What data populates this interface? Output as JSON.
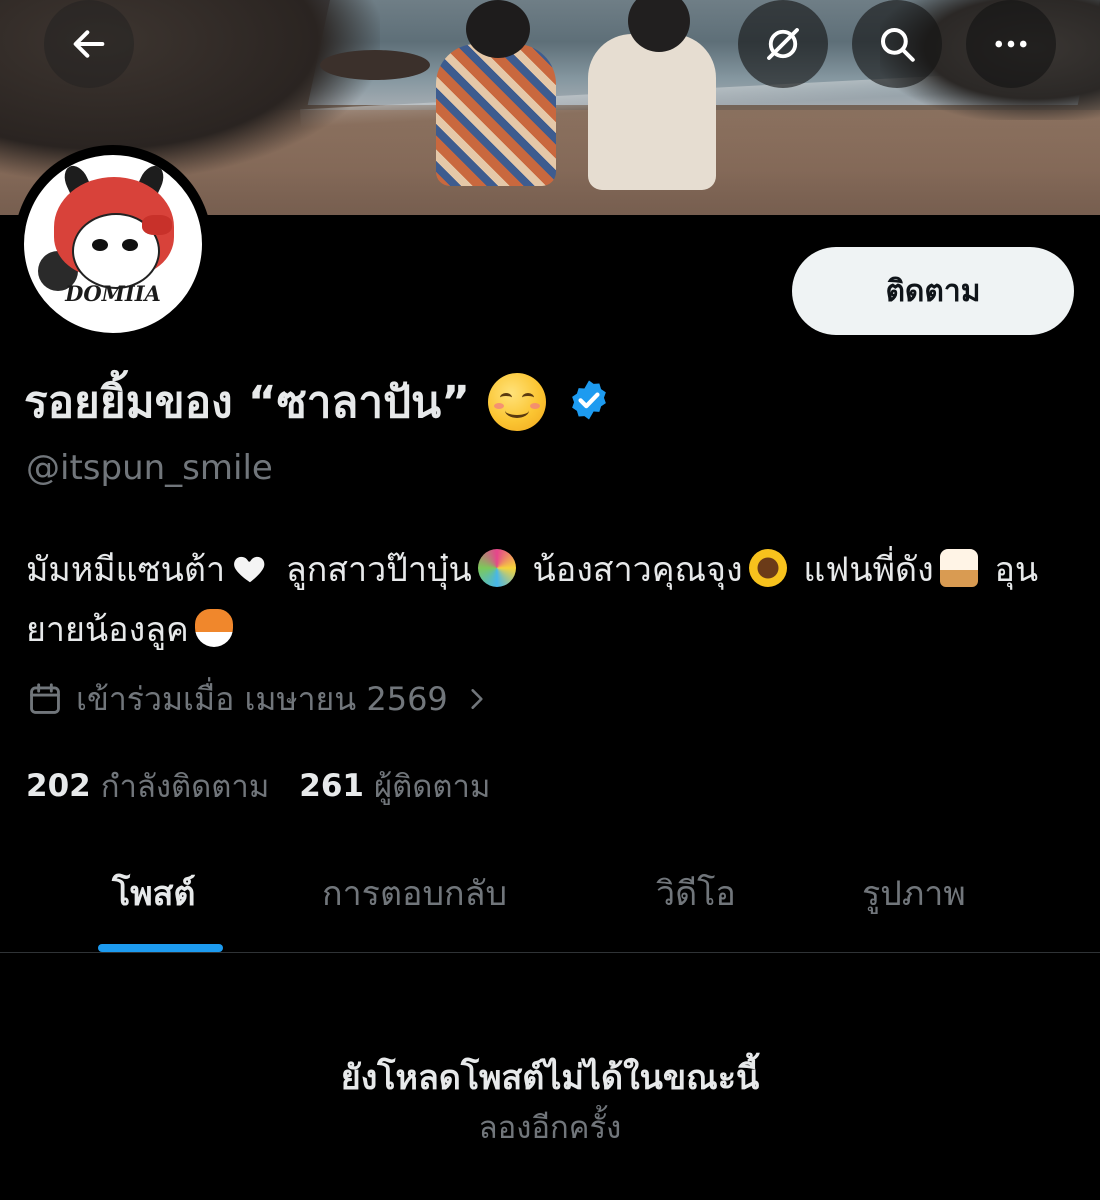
{
  "header": {
    "back_icon": "arrow-left-icon",
    "orbit_icon": "circle-slash-icon",
    "search_icon": "search-icon",
    "more_icon": "more-horizontal-icon"
  },
  "profile": {
    "avatar_text": "DOMIIA",
    "display_name": "รอยยิ้มของ “ซาลาปัน”",
    "name_emoji": "smiling-face-icon",
    "verified": true,
    "handle": "@itspun_smile",
    "bio_parts": [
      "มัมหมีแซนต้า",
      "ลูกสาวป๊าบุ๋น",
      "น้องสาวคุณจุง",
      "แฟนพี่ดัง",
      "อุนยายน้องลูค"
    ],
    "joined": "เข้าร่วมเมื่อ เมษายน 2569",
    "following_count": "202",
    "following_label": "กำลังติดตาม",
    "followers_count": "261",
    "followers_label": "ผู้ติดตาม",
    "follow_button": "ติดตาม"
  },
  "tabs": [
    {
      "label": "โพสต์",
      "active": true
    },
    {
      "label": "การตอบกลับ",
      "active": false
    },
    {
      "label": "วิดีโอ",
      "active": false
    },
    {
      "label": "รูปภาพ",
      "active": false
    }
  ],
  "empty_state": {
    "title": "ยังโหลดโพสต์ไม่ได้ในขณะนี้",
    "retry": "ลองอีกครั้ง"
  },
  "colors": {
    "background": "#000000",
    "accent": "#1d9bf0",
    "muted_text": "#71767b",
    "primary_text": "#e7e9ea"
  }
}
